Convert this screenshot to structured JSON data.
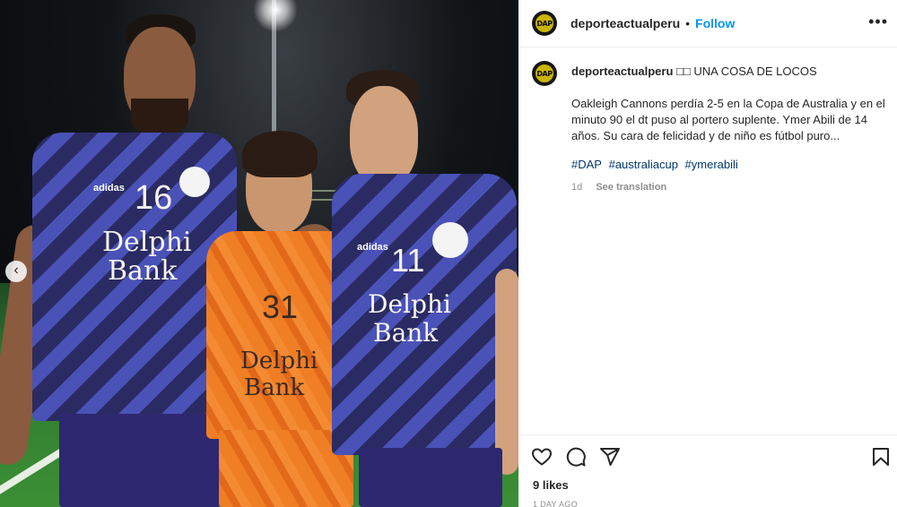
{
  "post": {
    "username": "deporteactualperu",
    "separator": "•",
    "follow_label": "Follow",
    "more_label": "•••",
    "avatar_text": "DAP",
    "caption": {
      "username": "deporteactualperu",
      "title": "□□ UNA COSA DE LOCOS",
      "text": "Oakleigh Cannons perdía 2-5 en la Copa de Australia y en el minuto 90 el dt puso al portero suplente. Ymer Abili de 14 años. Su cara de felicidad y de niño es fútbol puro...",
      "hashtags": [
        "#DAP",
        "#australiacup",
        "#ymerabili"
      ],
      "age": "1d",
      "translation_label": "See translation"
    },
    "likes": "9 likes",
    "time_ago": "1 DAY AGO"
  },
  "photo": {
    "carousel_prev": "‹",
    "players": [
      {
        "number": "16",
        "sponsor_line1": "Delphi",
        "sponsor_line2": "Bank",
        "brand": "adidas"
      },
      {
        "number": "31",
        "sponsor_line1": "Delphi",
        "sponsor_line2": "Bank"
      },
      {
        "number": "11",
        "sponsor_line1": "Delphi",
        "sponsor_line2": "Bank",
        "brand": "adidas"
      }
    ]
  },
  "icons": [
    "heart-icon",
    "comment-icon",
    "share-icon",
    "bookmark-icon",
    "chevron-left-icon",
    "more-icon"
  ],
  "colors": {
    "accent": "#0095f6",
    "hashtag": "#00376b",
    "muted": "#8e8e8e",
    "avatar_bg": "#161616",
    "avatar_logo": "#c9b400"
  }
}
